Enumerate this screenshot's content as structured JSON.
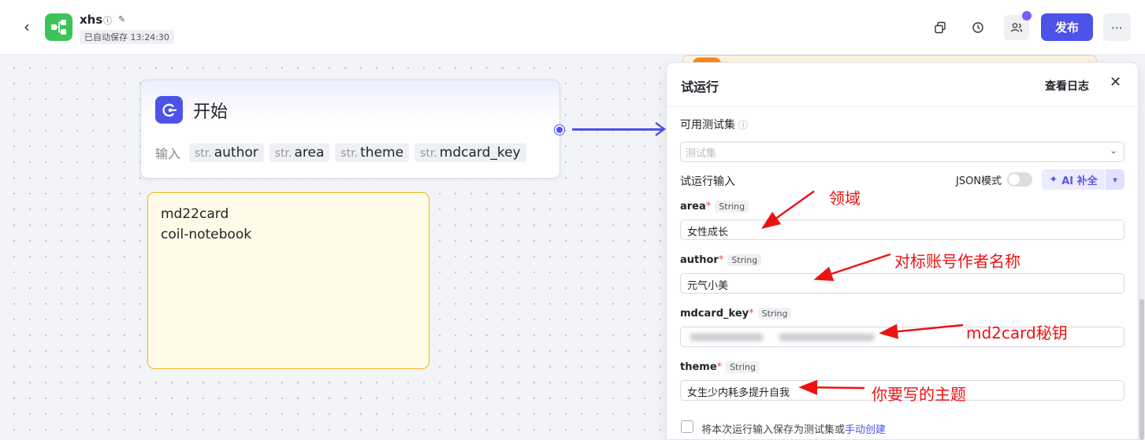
{
  "header": {
    "back_icon": "chevron-left-icon",
    "app_icon": "workflow-icon",
    "app_title": "xhs",
    "autosave": "已自动保存 13:24:30",
    "publish_label": "发布",
    "accent_color": "#4d53e8"
  },
  "start_node": {
    "title": "开始",
    "input_label": "输入",
    "type_prefix": "str.",
    "inputs": [
      "author",
      "area",
      "theme",
      "mdcard_key"
    ]
  },
  "note": {
    "lines": [
      "md22card",
      "coil-notebook"
    ]
  },
  "run_panel": {
    "title": "试运行",
    "view_log": "查看日志",
    "testset_label": "可用测试集",
    "testset_placeholder": "测试集",
    "run_input_label": "试运行输入",
    "json_mode_label": "JSON模式",
    "json_mode_on": false,
    "ai_fill_label": "AI 补全",
    "fields": [
      {
        "name": "area",
        "type": "String",
        "value": "女性成长"
      },
      {
        "name": "author",
        "type": "String",
        "value": "元气小美"
      },
      {
        "name": "mdcard_key",
        "type": "String",
        "value": ""
      },
      {
        "name": "theme",
        "type": "String",
        "value": "女生少内耗多提升自我"
      }
    ],
    "save_text": "将本次运行输入保存为测试集或",
    "manual_create": "手动创建"
  },
  "annotations": [
    "领域",
    "对标账号作者名称",
    "md2card秘钥",
    "你要写的主题"
  ]
}
